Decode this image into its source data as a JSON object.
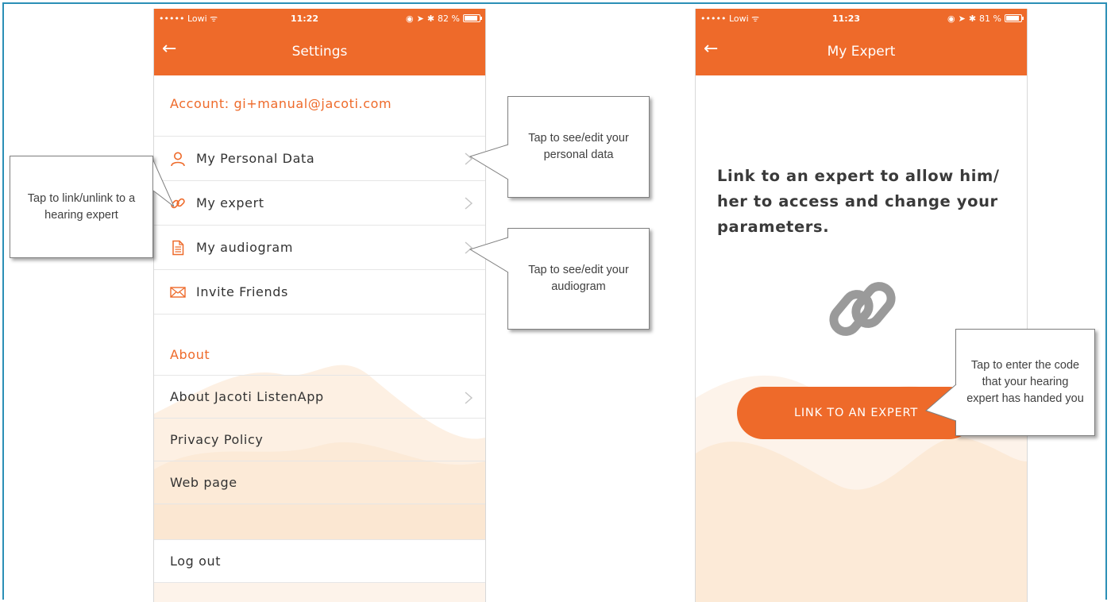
{
  "colors": {
    "brand": "#ee6a2a",
    "frame": "#2b8fb6",
    "text": "#333333",
    "callout_border": "#7f7f7f"
  },
  "screen1": {
    "status": {
      "carrier": "••••• Lowi",
      "time": "11:22",
      "battery": "82 %",
      "battery_level": 0.82
    },
    "title": "Settings",
    "account_label": "Account: gi+manual@jacoti.com",
    "items": [
      {
        "label": "My Personal Data",
        "icon": "person-icon"
      },
      {
        "label": "My expert",
        "icon": "link-icon"
      },
      {
        "label": "My audiogram",
        "icon": "document-icon"
      },
      {
        "label": "Invite Friends",
        "icon": "envelope-icon"
      }
    ],
    "about_title": "About",
    "about_items": [
      {
        "label": "About Jacoti ListenApp"
      },
      {
        "label": "Privacy Policy"
      },
      {
        "label": "Web page"
      }
    ],
    "logout_label": "Log out"
  },
  "screen2": {
    "status": {
      "carrier": "••••• Lowi",
      "time": "11:23",
      "battery": "81 %",
      "battery_level": 0.81
    },
    "title": "My Expert",
    "message": "Link to an expert to allow him/ her to access and change your parameters.",
    "button_label": "LINK TO AN EXPERT"
  },
  "callouts": {
    "personal_data": "Tap to see/edit your personal data",
    "expert": "Tap to link/unlink to a hearing expert",
    "audiogram": "Tap to see/edit your audiogram",
    "enter_code": "Tap to enter the code that your hearing expert has handed you"
  }
}
